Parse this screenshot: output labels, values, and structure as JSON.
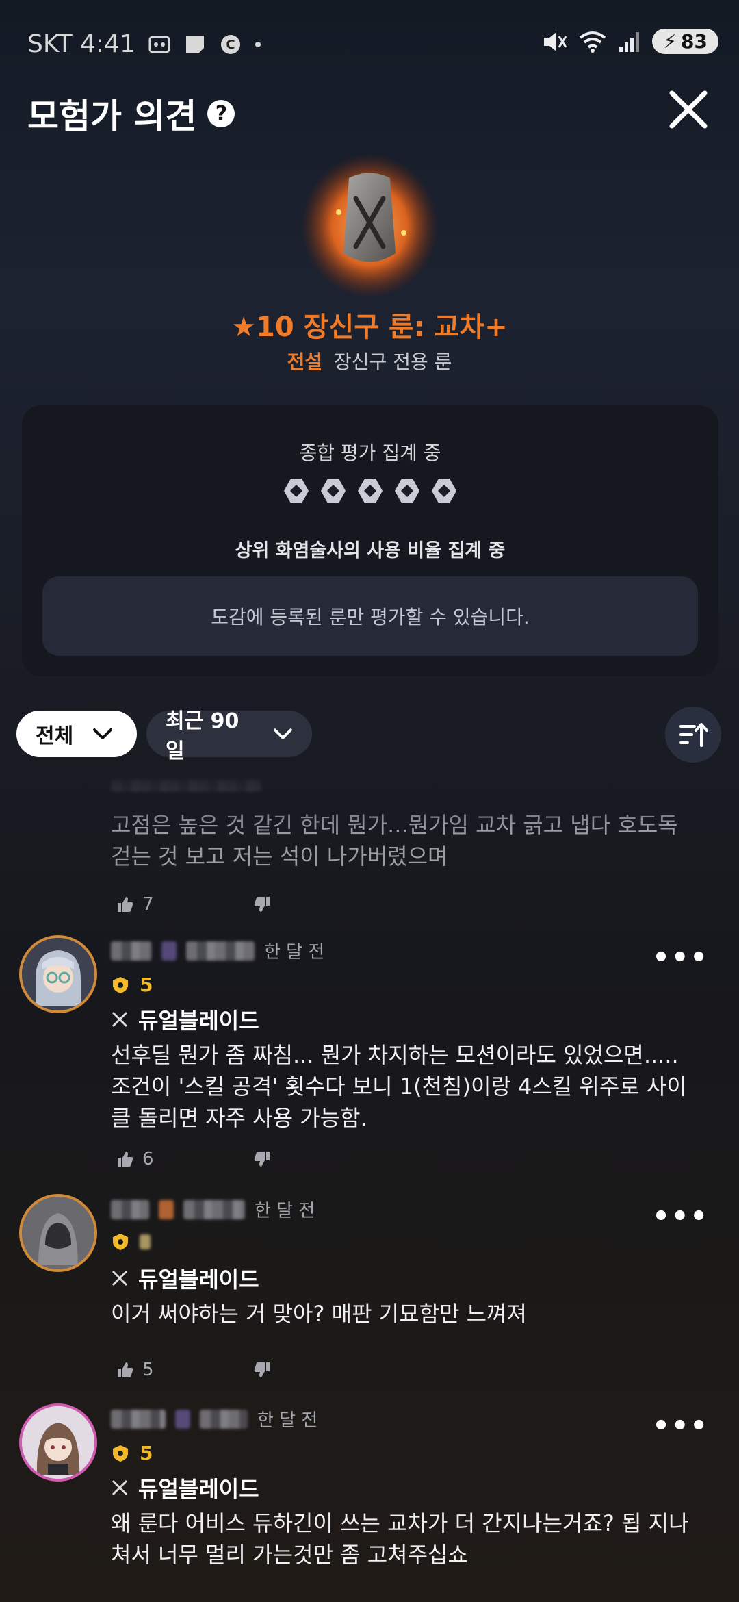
{
  "status_bar": {
    "carrier_time": "SKT 4:41",
    "battery": "83"
  },
  "header": {
    "title": "모험가 의견"
  },
  "item": {
    "name": "★10 장신구 룬: 교차+",
    "grade": "전설",
    "type": "장신구 전용 룬"
  },
  "rating": {
    "overall_label": "종합 평가 집계 중",
    "usage_label": "상위 화염술사의 사용 비율 집계 중",
    "notice": "도감에 등록된 룬만 평가할 수 있습니다."
  },
  "filters": {
    "scope": "전체",
    "period": "최근 90일"
  },
  "comments": [
    {
      "partial": true,
      "text": "고점은 높은 것 같긴 한데 뭔가...뭔가임 교차 긁고 냅다 호도독 걷는 것 보고 저는 석이 나가버렸으며",
      "likes": "7"
    },
    {
      "time": "한 달 전",
      "level": "5",
      "class": "듀얼블레이드",
      "text": "선후딜 뭔가 좀 짜침... 뭔가 차지하는 모션이라도 있었으면..... 조건이 '스킬 공격' 횟수다 보니 1(천침)이랑 4스킬 위주로 사이클 돌리면 자주 사용 가능함.",
      "likes": "6"
    },
    {
      "time": "한 달 전",
      "level": "",
      "class": "듀얼블레이드",
      "text": "이거 써야하는 거 맞아? 매판 기묘함만 느껴져",
      "likes": "5"
    },
    {
      "time": "한 달 전",
      "level": "5",
      "class": "듀얼블레이드",
      "text": "왜 룬다 어비스 듀하긴이 쓰는 교차가 더 간지나는거죠? 됩 지나쳐서 너무 멀리 가는것만 좀 고쳐주십쇼",
      "likes": ""
    }
  ],
  "colors": {
    "accent": "#f07c2a",
    "badge": "#f2b92a"
  }
}
